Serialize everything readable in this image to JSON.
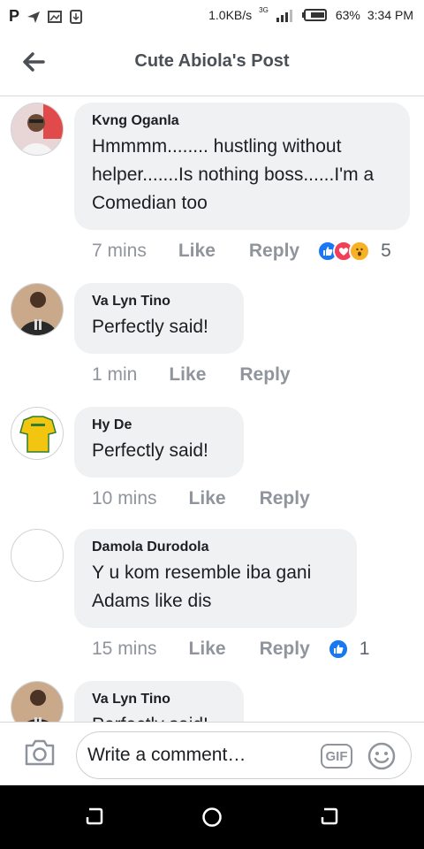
{
  "status_bar": {
    "speed": "1.0KB/s",
    "network": "3G",
    "battery": "63%",
    "time": "3:34 PM"
  },
  "header": {
    "title": "Cute Abiola's Post"
  },
  "comments": [
    {
      "author": "Kvng Oganla",
      "text": "Hmmmm........ hustling without helper.......Is nothing boss......I'm a Comedian too",
      "time": "7 mins",
      "like": "Like",
      "reply": "Reply",
      "reaction_count": "5"
    },
    {
      "author": "Va Lyn Tino",
      "text": "Perfectly said!",
      "time": "1 min",
      "like": "Like",
      "reply": "Reply"
    },
    {
      "author": "Hy De",
      "text": "Perfectly said!",
      "time": "10 mins",
      "like": "Like",
      "reply": "Reply"
    },
    {
      "author": "Damola Durodola",
      "text": "Y u kom resemble iba gani Adams like dis",
      "time": "15 mins",
      "like": "Like",
      "reply": "Reply",
      "reaction_count": "1"
    },
    {
      "author": "Va Lyn Tino",
      "text": "Perfectly said!"
    }
  ],
  "composer": {
    "placeholder": "Write a comment…",
    "gif_label": "GIF"
  },
  "colors": {
    "like_blue": "#1877f2",
    "love_red": "#f33e58",
    "wow_yellow": "#f7b125",
    "bubble_bg": "#f0f1f3"
  }
}
